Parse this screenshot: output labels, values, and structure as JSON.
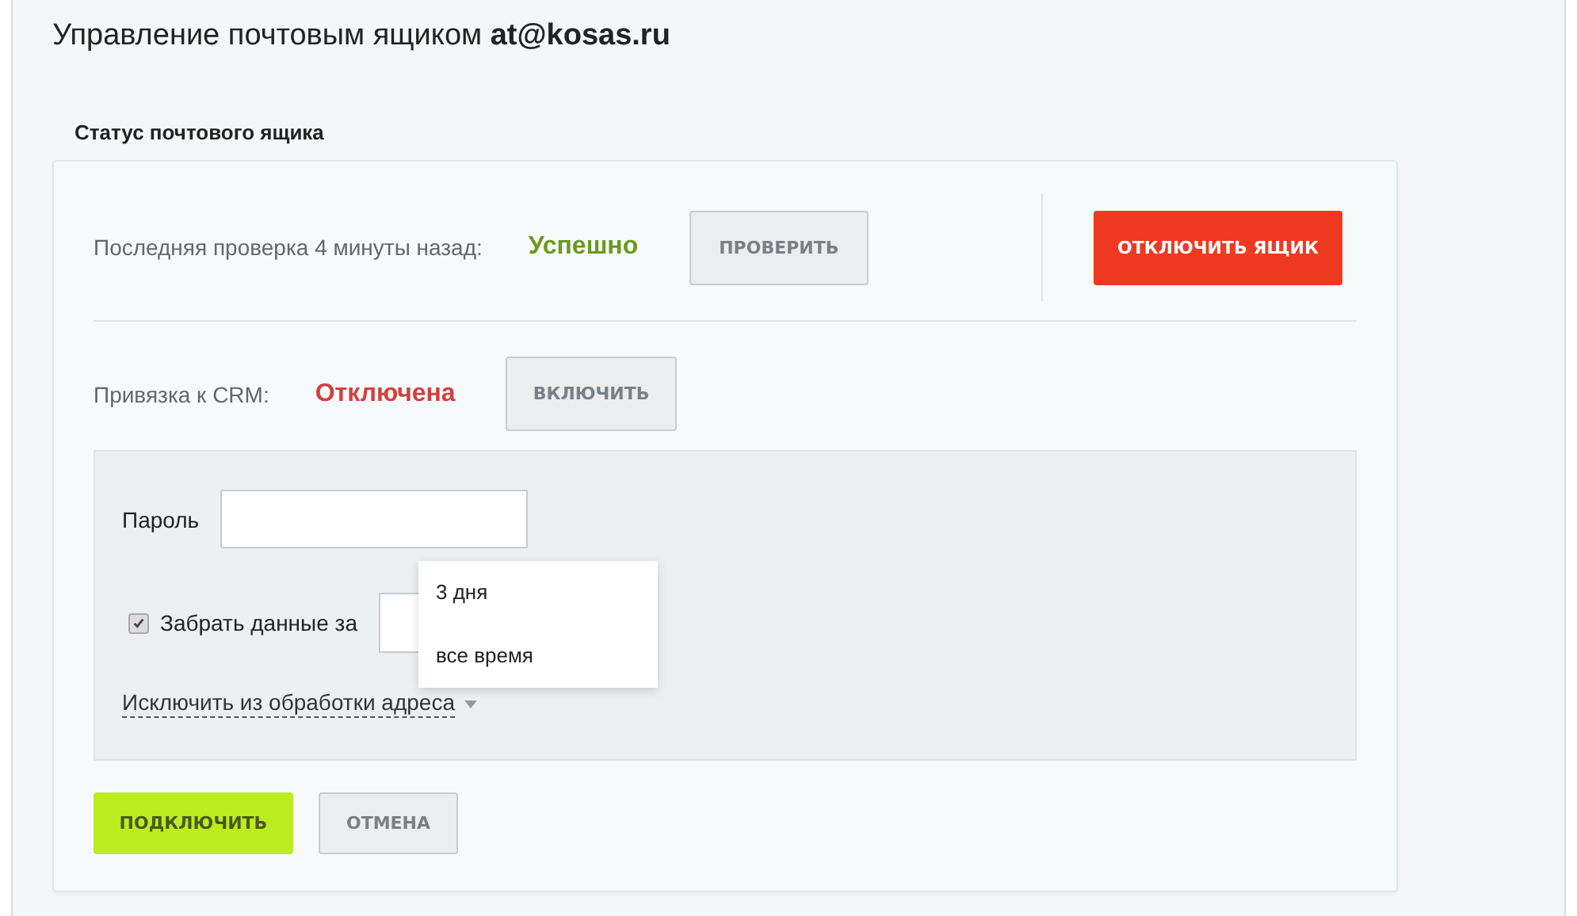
{
  "page_title": "Управление почтовым ящиком **at@kosas.ru**",
  "section_title": "Статус почтового ящика",
  "check_row": {
    "label": "Последняя проверка 4 минуты назад:",
    "status": {
      "text": "Успешно",
      "kind": "success"
    },
    "button": "ПРОВЕРИТЬ"
  },
  "disconnect_button": "ОТКЛЮЧИТЬ ЯЩИК",
  "crm_row": {
    "label": "Привязка к CRM:",
    "status": {
      "text": "Отключена",
      "kind": "off"
    },
    "button": "ВКЛЮЧИТЬ"
  },
  "form": {
    "password": {
      "label": "Пароль"
    },
    "fetch_period": {
      "label": "Забрать данные за",
      "checked": true,
      "dropdown_open": true,
      "options": [
        {
          "label": "3 дня",
          "selected": false
        },
        {
          "label": "все время",
          "selected": false
        }
      ]
    },
    "exclude_link": "Исключить из обработки адреса"
  },
  "buttons": [
    {
      "label": "ПОДКЛЮЧИТЬ",
      "kind": "primary"
    },
    {
      "label": "ОТМЕНА",
      "kind": "secondary"
    }
  ]
}
